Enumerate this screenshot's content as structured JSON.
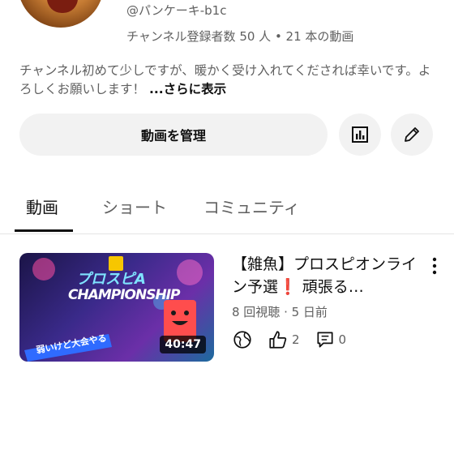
{
  "channel": {
    "handle": "@パンケーキ-b1c",
    "stats": "チャンネル登録者数 50 人 • 21 本の動画",
    "description": "チャンネル初めて少しですが、暖かく受け入れてくだされば幸いです。よろしくお願いします！ ",
    "more_label": "...さらに表示"
  },
  "actions": {
    "manage_label": "動画を管理",
    "analytics_icon": "analytics-icon",
    "edit_icon": "pencil-icon"
  },
  "tabs": [
    {
      "label": "動画",
      "active": true
    },
    {
      "label": "ショート",
      "active": false
    },
    {
      "label": "コミュニティ",
      "active": false
    }
  ],
  "videos": [
    {
      "title": "【雑魚】プロスピオンライン予選❗ 頑張る…",
      "meta": "8 回視聴 · 5 日前",
      "duration": "40:47",
      "likes": "2",
      "comments": "0",
      "thumbnail_text": {
        "line1": "プロスピA",
        "line2": "CHAMPIONSHIP",
        "tagline": "弱いけど大会やる"
      }
    }
  ],
  "colors": {
    "text_primary": "#0f0f0f",
    "text_secondary": "#606060",
    "button_bg": "#f2f2f2",
    "divider": "#e5e5e5"
  }
}
